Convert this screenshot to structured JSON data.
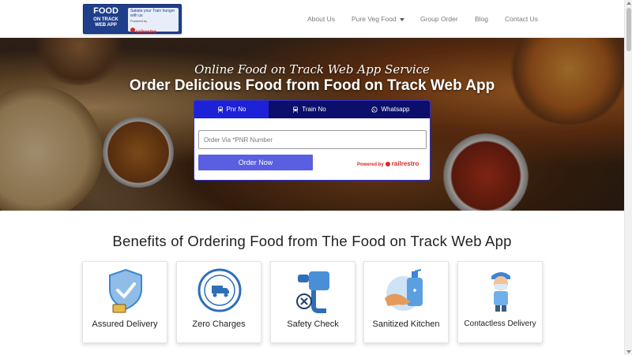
{
  "header": {
    "logo": {
      "line1": "FOOD",
      "line2": "ON TRACK",
      "line3": "WEB APP",
      "tagline": "Satiate your Train hunger with us",
      "powered_by": "Powered by",
      "partner": "railrestro"
    },
    "nav": {
      "about": "About Us",
      "pure_veg": "Pure Veg Food",
      "group_order": "Group Order",
      "blog": "Blog",
      "contact": "Contact Us"
    }
  },
  "hero": {
    "script_title": "Online Food on Track Web App Service",
    "title": "Order Delicious Food from Food on Track Web App"
  },
  "order_card": {
    "tabs": {
      "pnr": "Pnr No",
      "train": "Train No",
      "whatsapp": "Whatsapp"
    },
    "active_tab": "Pnr No",
    "input_placeholder": "Order Via *PNR Number",
    "button_label": "Order Now",
    "powered_label": "Powered by",
    "partner_logo": "railrestro",
    "colors": {
      "tab_bar": "#0b0e6b",
      "active_tab": "#1d21d8",
      "button": "#5a5ee0",
      "partner": "#d62828"
    }
  },
  "benefits": {
    "title": "Benefits of Ordering Food from The Food on Track Web App",
    "items": [
      {
        "label": "Assured Delivery",
        "icon": "shield-check-icon"
      },
      {
        "label": "Zero Charges",
        "icon": "free-delivery-stamp-icon"
      },
      {
        "label": "Safety Check",
        "icon": "thermometer-check-icon"
      },
      {
        "label": "Sanitized Kitchen",
        "icon": "sanitizer-hand-icon"
      },
      {
        "label": "Contactless Delivery",
        "icon": "masked-delivery-person-icon"
      }
    ]
  }
}
